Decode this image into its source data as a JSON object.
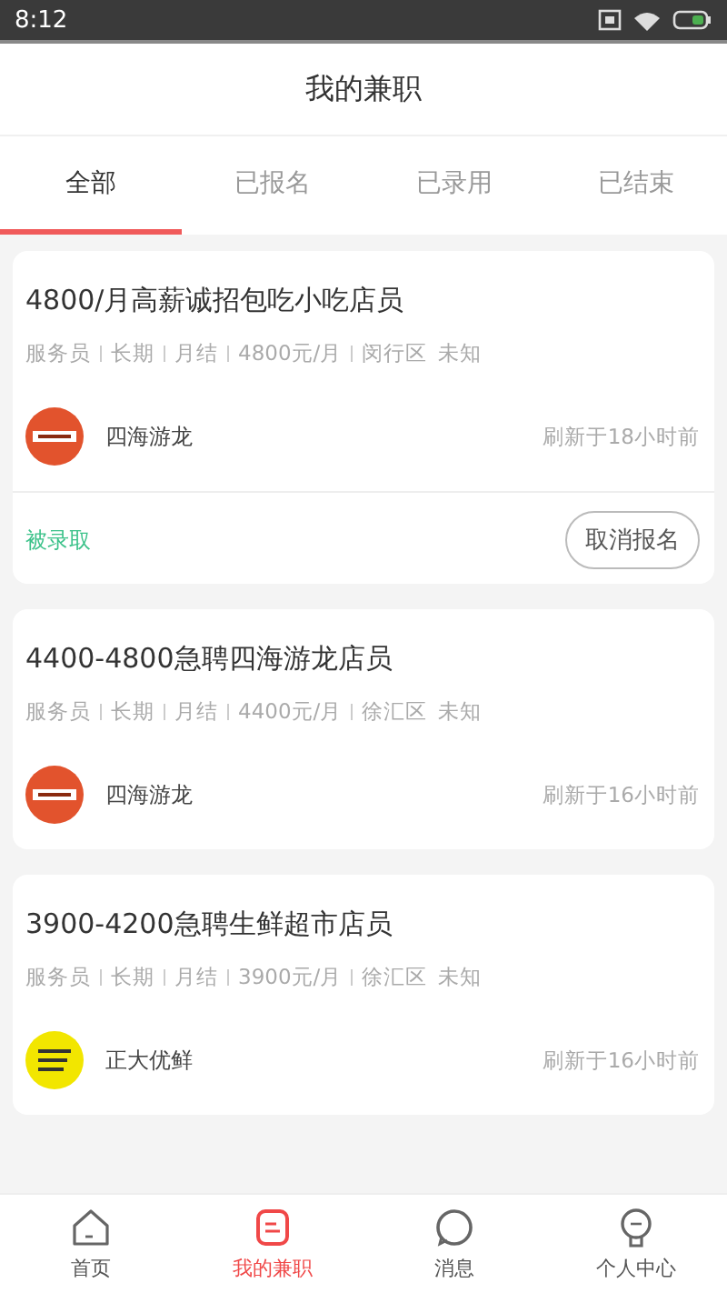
{
  "status_bar": {
    "time": "8:12"
  },
  "header": {
    "title": "我的兼职"
  },
  "tabs": [
    {
      "label": "全部",
      "selected": true
    },
    {
      "label": "已报名",
      "selected": false
    },
    {
      "label": "已录用",
      "selected": false
    },
    {
      "label": "已结束",
      "selected": false
    }
  ],
  "jobs": [
    {
      "title": "4800/月高薪诚招包吃小吃店员",
      "tags": [
        "服务员",
        "长期",
        "月结",
        "4800元/月",
        "闵行区"
      ],
      "distance": "未知",
      "company": "四海游龙",
      "logo": {
        "color": "#e2532d"
      },
      "refreshed": "刷新于18小时前",
      "status": "被录取",
      "action": "取消报名"
    },
    {
      "title": "4400-4800急聘四海游龙店员",
      "tags": [
        "服务员",
        "长期",
        "月结",
        "4400元/月",
        "徐汇区"
      ],
      "distance": "未知",
      "company": "四海游龙",
      "logo": {
        "color": "#e2532d"
      },
      "refreshed": "刷新于16小时前"
    },
    {
      "title": "3900-4200急聘生鲜超市店员",
      "tags": [
        "服务员",
        "长期",
        "月结",
        "3900元/月",
        "徐汇区"
      ],
      "distance": "未知",
      "company": "正大优鲜",
      "logo": {
        "color": "#f2e600"
      },
      "refreshed": "刷新于16小时前"
    }
  ],
  "nav": [
    {
      "kind": "home",
      "label": "首页",
      "selected": false
    },
    {
      "kind": "jobs",
      "label": "我的兼职",
      "selected": true
    },
    {
      "kind": "message",
      "label": "消息",
      "selected": false
    },
    {
      "kind": "profile",
      "label": "个人中心",
      "selected": false
    }
  ]
}
